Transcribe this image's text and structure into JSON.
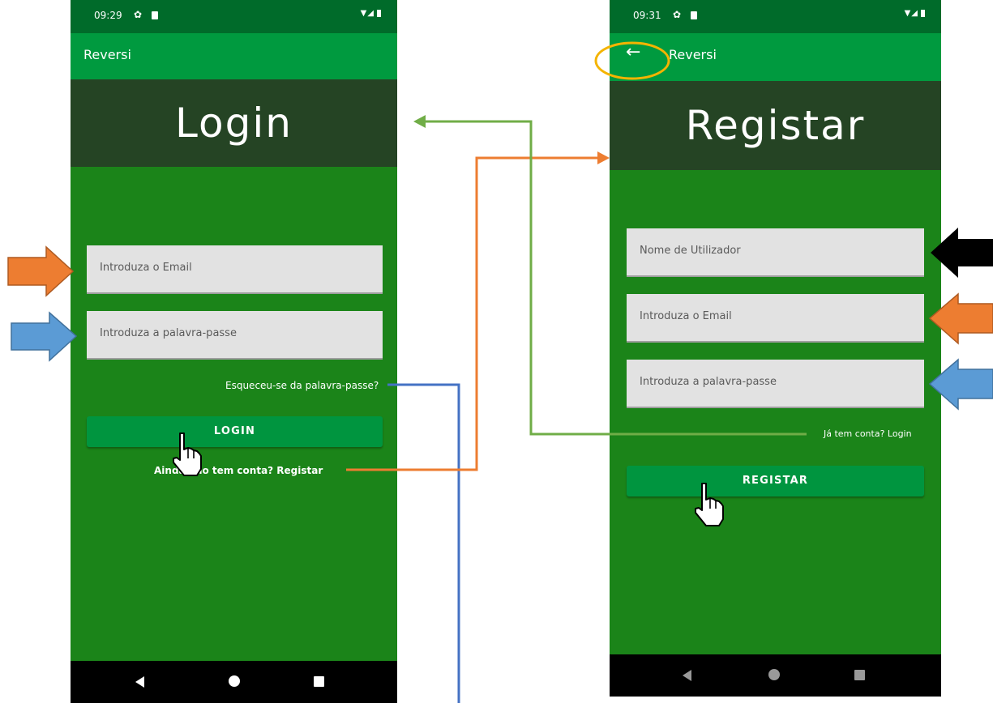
{
  "login_screen": {
    "status_time": "09:29",
    "app_title": "Reversi",
    "header_title": "Login",
    "email_placeholder": "Introduza o Email",
    "password_placeholder": "Introduza a palavra-passe",
    "forgot_link": "Esqueceu-se da palavra-passe?",
    "login_button": "LOGIN",
    "register_link": "Ainda não tem conta? Registar"
  },
  "register_screen": {
    "status_time": "09:31",
    "app_title": "Reversi",
    "header_title": "Registar",
    "username_placeholder": "Nome de Utilizador",
    "email_placeholder": "Introduza o Email",
    "password_placeholder": "Introduza a palavra-passe",
    "login_link": "Já tem conta? Login",
    "register_button": "REGISTAR"
  },
  "icons": {
    "back": "arrow-left-icon",
    "settings": "gear-icon",
    "sdcard": "sd-card-icon",
    "cursor": "hand-pointer-icon"
  },
  "colors": {
    "screen_background": "#1b8419",
    "status_bar": "#006b2a",
    "app_bar": "#009a3f",
    "header_band": "#254424",
    "button": "#00953f",
    "field": "#e2e2e2",
    "annotation_orange": "#ed7d31",
    "annotation_blue": "#5b9bd5",
    "annotation_green": "#70ad47",
    "annotation_yellow": "#f4b400",
    "annotation_black": "#000000"
  }
}
